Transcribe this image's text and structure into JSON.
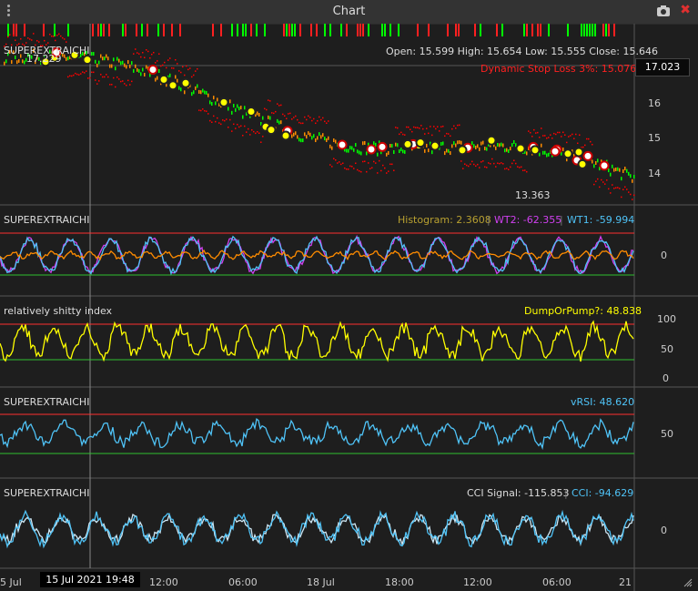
{
  "window": {
    "title": "Chart"
  },
  "panels": [
    {
      "label": "SUPEREXTRAICHI"
    },
    {
      "label": "SUPEREXTRAICHI"
    },
    {
      "label": "relatively shitty index"
    },
    {
      "label": "SUPEREXTRAICHI"
    },
    {
      "label": "SUPEREXTRAICHI"
    }
  ],
  "main": {
    "ohlc": "Open: 15.599 High: 15.654 Low: 15.555 Close: 15.646",
    "stop_loss": "Dynamic Stop Loss 3%: 15.076",
    "high_label": "17.229",
    "low_label": "13.363",
    "current_price": "17.023",
    "yticks": [
      "16",
      "15",
      "14"
    ]
  },
  "wavetrend": {
    "histogram": "Histogram: 2.3608",
    "wt2": "WT2: -62.355",
    "wt1": "WT1: -59.994",
    "yticks": [
      "0"
    ]
  },
  "rsi_index": {
    "dump": "DumpOrPump?: 48.838",
    "yticks": [
      "100",
      "50",
      "0"
    ]
  },
  "vrsi": {
    "vrsi": "vRSI: 48.620",
    "yticks": [
      "50"
    ]
  },
  "cci": {
    "signal": "CCI Signal: -115.853",
    "cci": "CCI: -94.629",
    "yticks": [
      "0"
    ]
  },
  "xaxis": {
    "ticks": [
      "5 Jul",
      "12:00",
      "06:00",
      "18 Jul",
      "18:00",
      "12:00",
      "06:00",
      "21"
    ],
    "crosshair_time": "15 Jul 2021 19:48"
  },
  "colors": {
    "bg": "#1e1e1e",
    "up": "#00ff00",
    "down": "#ff2020",
    "stop": "#ff0000",
    "wt1": "#4fc3f7",
    "wt2": "#d040f0",
    "hist": "#ff8c00",
    "yellow": "#ffff00",
    "cyan": "#4fc3f7",
    "band_red": "#ff3030",
    "band_green": "#30c030"
  }
}
